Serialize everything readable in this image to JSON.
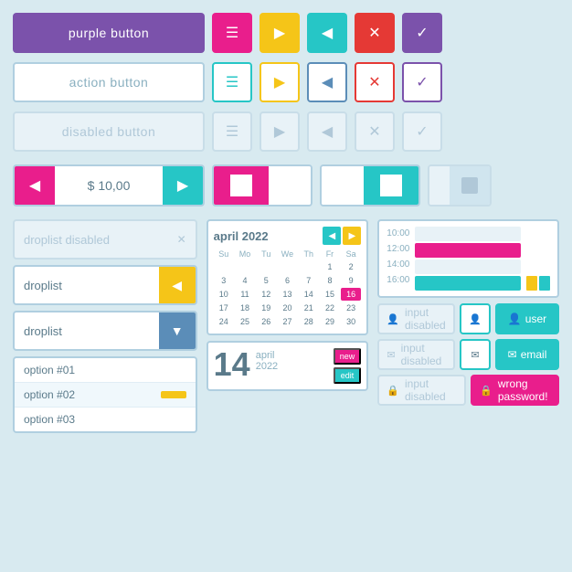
{
  "buttons": {
    "purple_label": "purple button",
    "action_label": "action button",
    "disabled_label": "disabled button",
    "stepper_value": "$ 10,00"
  },
  "icons": {
    "menu": "☰",
    "play": "▶",
    "back": "◀",
    "close": "✕",
    "check": "✓",
    "arrow_down": "▼",
    "arrow_left": "◀",
    "lock": "🔒",
    "user": "👤",
    "email": "✉"
  },
  "droplists": {
    "disabled_label": "droplist disabled",
    "yellow_label": "droplist",
    "blue_label": "droplist",
    "options": [
      "option #01",
      "option #02",
      "option #03"
    ]
  },
  "calendar": {
    "title": "april 2022",
    "days_header": [
      "Su",
      "Mo",
      "Tu",
      "We",
      "Th",
      "Fr",
      "Sa"
    ],
    "today": 16
  },
  "date_widget": {
    "day": "14",
    "month": "april",
    "year": "2022",
    "new_label": "new",
    "edit_label": "edit"
  },
  "time_slots": [
    "10:00",
    "12:00",
    "14:00",
    "16:00"
  ],
  "inputs": {
    "disabled_placeholder": "input disabled",
    "user_label": "user",
    "email_label": "email",
    "error_label": "wrong password!"
  }
}
